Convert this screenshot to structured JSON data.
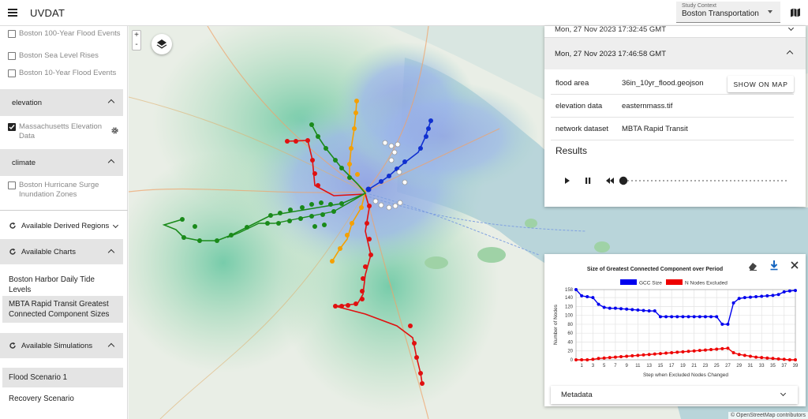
{
  "app": {
    "title": "UVDAT"
  },
  "context": {
    "label": "Study Context",
    "value": "Boston Transportation"
  },
  "sidebar": {
    "flood_layers": [
      {
        "label": "Boston 100-Year Flood Events",
        "checked": false
      },
      {
        "label": "Boston Sea Level Rises",
        "checked": false
      },
      {
        "label": "Boston 10-Year Flood Events",
        "checked": false
      }
    ],
    "elevation_group": {
      "title": "elevation"
    },
    "elevation_layers": [
      {
        "label": "Massachusetts Elevation Data",
        "checked": true
      }
    ],
    "climate_group": {
      "title": "climate"
    },
    "climate_layers": [
      {
        "label": "Boston Hurricane Surge Inundation Zones",
        "checked": false
      }
    ],
    "derived_regions": {
      "title": "Available Derived Regions"
    },
    "charts": {
      "title": "Available Charts",
      "items": [
        {
          "label": "Boston Harbor Daily Tide Levels",
          "selected": false
        },
        {
          "label": "MBTA Rapid Transit Greatest Connected Component Sizes",
          "selected": true
        }
      ]
    },
    "simulations": {
      "title": "Available Simulations",
      "items": [
        {
          "label": "Flood Scenario 1",
          "selected": true
        },
        {
          "label": "Recovery Scenario",
          "selected": false
        }
      ]
    }
  },
  "map": {
    "zoom_in": "+",
    "zoom_out": "-",
    "attribution": "© OpenStreetMap contributors"
  },
  "simulation_panel": {
    "previous_run": "Mon, 27 Nov 2023 17:32:45 GMT",
    "current_run": "Mon, 27 Nov 2023 17:46:58 GMT",
    "rows": [
      {
        "key": "flood area",
        "value": "36in_10yr_flood.geojson"
      },
      {
        "key": "elevation data",
        "value": "easternmass.tif"
      },
      {
        "key": "network dataset",
        "value": "MBTA Rapid Transit"
      }
    ],
    "show_on_map": "SHOW ON MAP",
    "results_title": "Results"
  },
  "chart_panel": {
    "metadata_label": "Metadata"
  },
  "colors": {
    "gcc": "#0000ee",
    "excluded": "#ee0000"
  },
  "chart_data": {
    "type": "line",
    "title": "Size of Greatest Connected Component over Period",
    "xlabel": "Step when Excluded Nodes Changed",
    "ylabel": "Number of Nodes",
    "ylim": [
      0,
      158
    ],
    "yticks": [
      0,
      20,
      40,
      60,
      80,
      100,
      120,
      140,
      158
    ],
    "xticks": [
      1,
      3,
      5,
      7,
      9,
      11,
      13,
      15,
      17,
      19,
      21,
      23,
      25,
      27,
      29,
      31,
      33,
      35,
      37,
      39
    ],
    "grid": true,
    "legend": "top",
    "x": [
      0,
      1,
      2,
      3,
      4,
      5,
      6,
      7,
      8,
      9,
      10,
      11,
      12,
      13,
      14,
      15,
      16,
      17,
      18,
      19,
      20,
      21,
      22,
      23,
      24,
      25,
      26,
      27,
      28,
      29,
      30,
      31,
      32,
      33,
      34,
      35,
      36,
      37,
      38,
      39
    ],
    "series": [
      {
        "name": "GCC Size",
        "values": [
          158,
          144,
          142,
          140,
          125,
          118,
          116,
          116,
          115,
          114,
          113,
          112,
          111,
          110,
          110,
          97,
          97,
          97,
          97,
          97,
          97,
          97,
          97,
          97,
          97,
          97,
          80,
          80,
          128,
          138,
          140,
          141,
          142,
          143,
          144,
          145,
          147,
          153,
          155,
          156
        ]
      },
      {
        "name": "N Nodes Excluded",
        "values": [
          0,
          0,
          0,
          1,
          3,
          4,
          5,
          6,
          7,
          8,
          9,
          10,
          11,
          12,
          13,
          14,
          15,
          16,
          17,
          18,
          19,
          20,
          21,
          22,
          23,
          24,
          25,
          26,
          16,
          12,
          10,
          8,
          6,
          5,
          4,
          3,
          2,
          1,
          0,
          0
        ]
      }
    ]
  }
}
